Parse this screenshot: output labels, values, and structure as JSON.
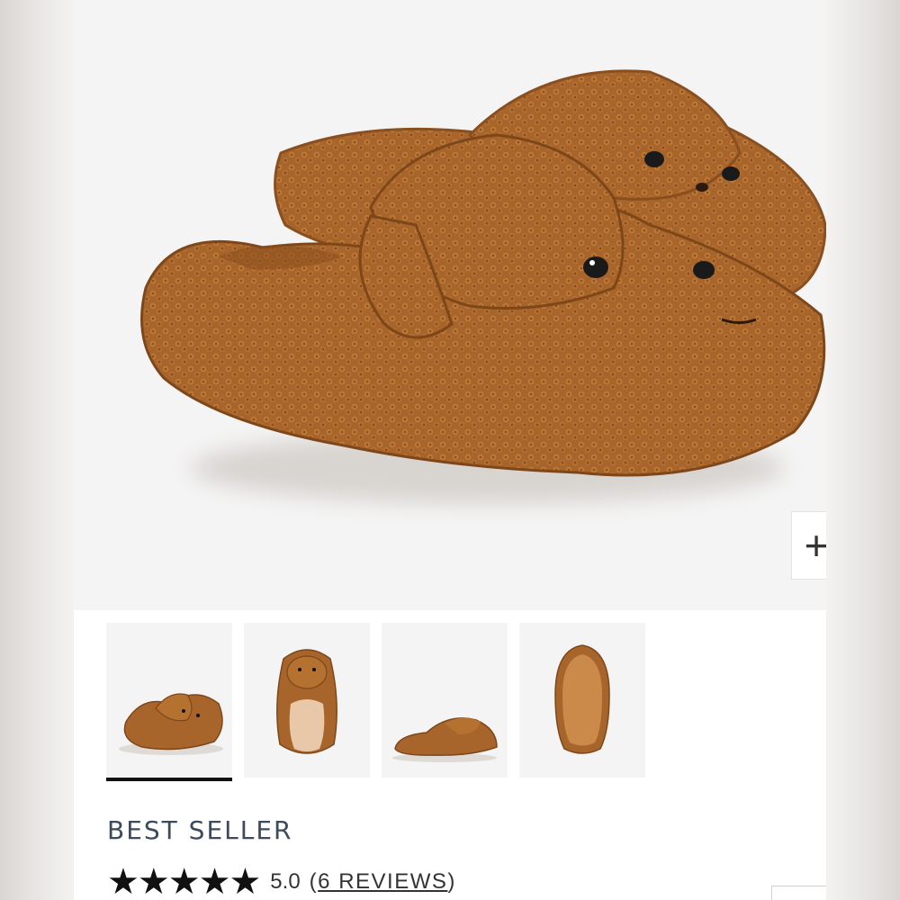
{
  "product": {
    "badge": "BEST SELLER",
    "rating_value": "5.0",
    "reviews_open": "(",
    "reviews_label": "6 REVIEWS",
    "reviews_close": ")",
    "stars": 5
  },
  "gallery": {
    "zoom_label": "+",
    "thumbnails": [
      {
        "view": "angle-pair",
        "selected": true
      },
      {
        "view": "top",
        "selected": false
      },
      {
        "view": "side",
        "selected": false
      },
      {
        "view": "sole",
        "selected": false
      }
    ]
  },
  "colors": {
    "fur": "#a8652b",
    "fur_light": "#c07a3a",
    "fur_dark": "#7d4719",
    "sole": "#c98a4a",
    "badge_text": "#3d4a5c"
  },
  "icons": {
    "zoom": "plus-icon",
    "star": "star-icon"
  }
}
